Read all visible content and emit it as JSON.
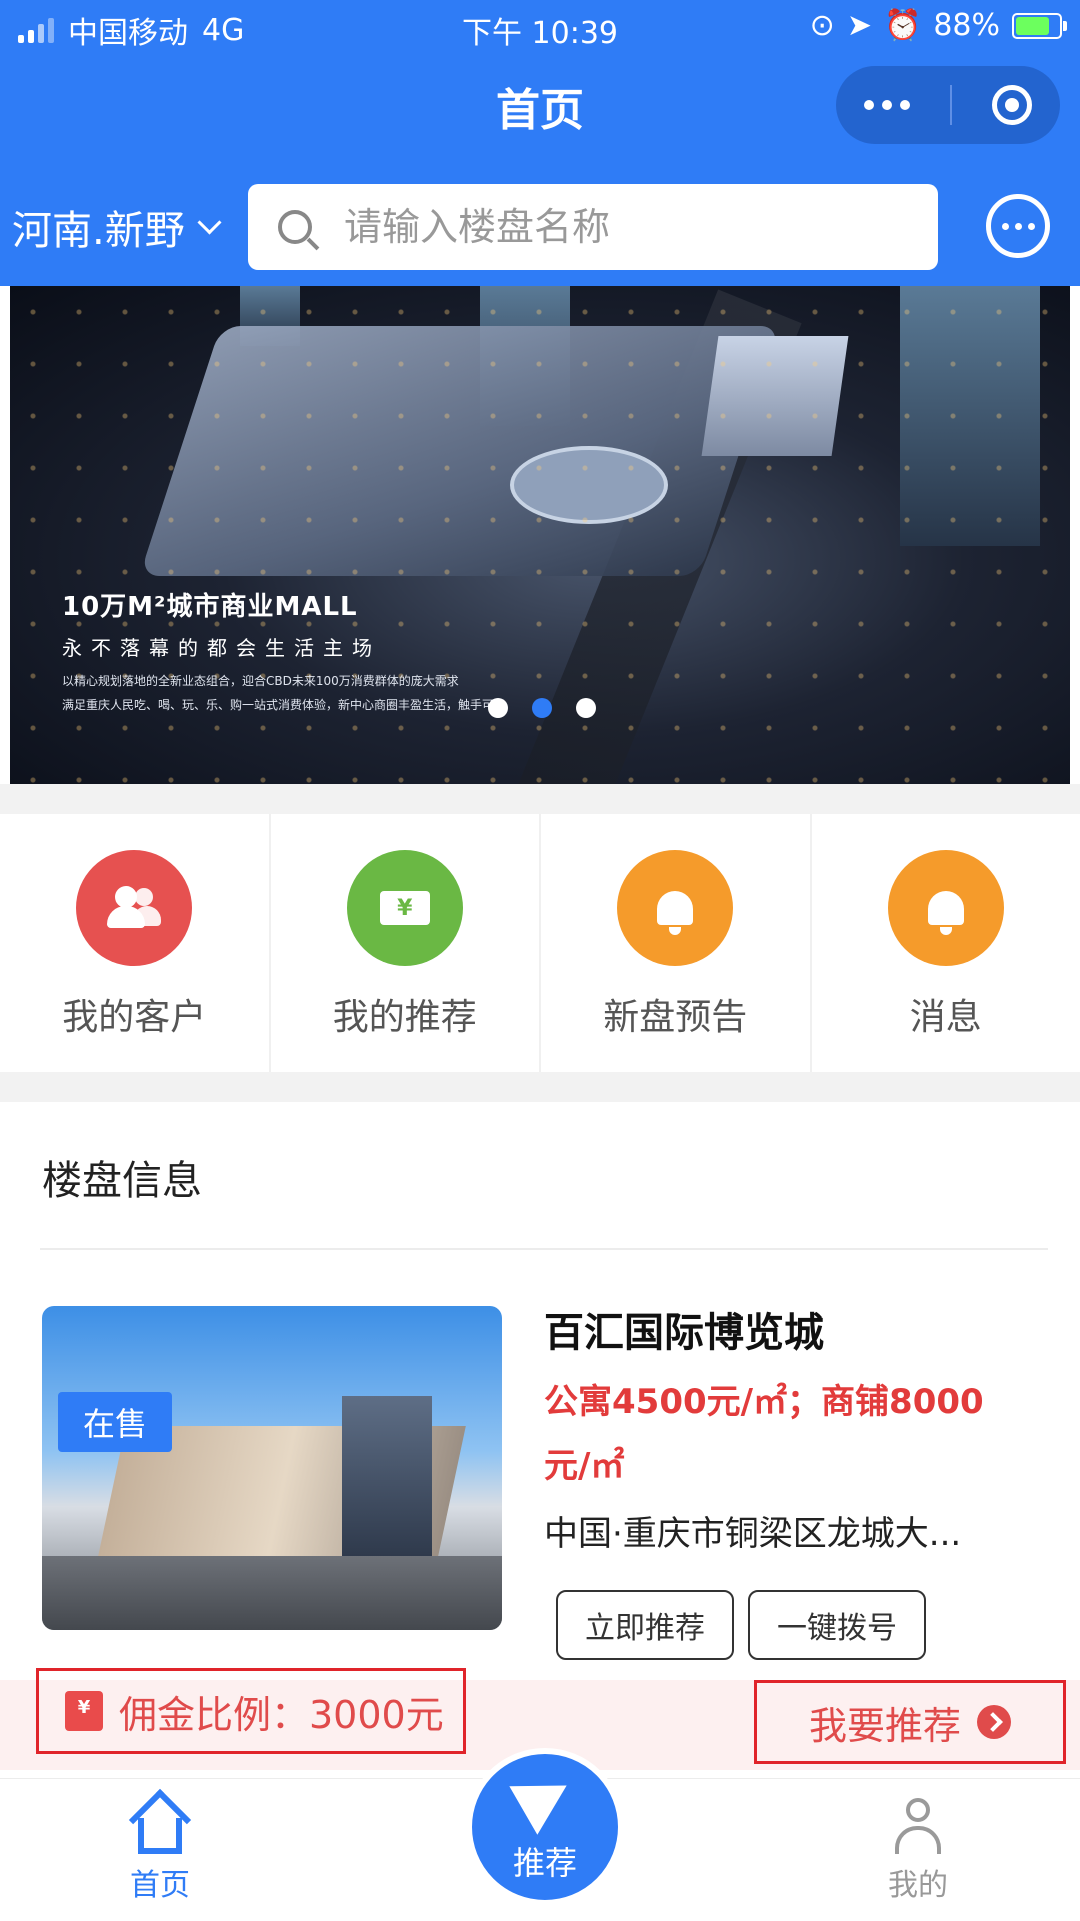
{
  "status_bar": {
    "carrier": "中国移动",
    "network": "4G",
    "time": "下午 10:39",
    "battery": "88%",
    "battery_level": 0.88
  },
  "header": {
    "title": "首页",
    "location": "河南.新野",
    "search_placeholder": "请输入楼盘名称"
  },
  "banner": {
    "headline": "10万M²城市商业MALL",
    "tagline": "永不落幕的都会生活主场",
    "desc_line1": "以精心规划落地的全新业态组合，迎合CBD未来100万消费群体的庞大需求",
    "desc_line2": "满足重庆人民吃、喝、玩、乐、购一站式消费体验，新中心商圈丰盈生活，触手可及",
    "active_dot": 2,
    "dot_count": 3
  },
  "quick_menu": [
    {
      "label": "我的客户",
      "icon": "users-icon",
      "color": "#e65150"
    },
    {
      "label": "我的推荐",
      "icon": "ticket-icon",
      "color": "#6ab844"
    },
    {
      "label": "新盘预告",
      "icon": "bell-icon",
      "color": "#f59b2b"
    },
    {
      "label": "消息",
      "icon": "bell-icon",
      "color": "#f59b2b"
    }
  ],
  "section": {
    "title": "楼盘信息"
  },
  "property": {
    "badge": "在售",
    "name": "百汇国际博览城",
    "price_line1": "公寓4500元/㎡；商铺8000",
    "price_line2": "元/㎡",
    "address": "中国·重庆市铜梁区龙城大...",
    "btn_recommend": "立即推荐",
    "btn_call": "一键拨号",
    "commission": "佣金比例：3000元",
    "want_recommend": "我要推荐"
  },
  "tabbar": {
    "home": "首页",
    "recommend": "推荐",
    "me": "我的"
  },
  "colors": {
    "primary": "#2f7cf6",
    "price": "#e23b3b",
    "highlight_box": "#e0242a"
  }
}
